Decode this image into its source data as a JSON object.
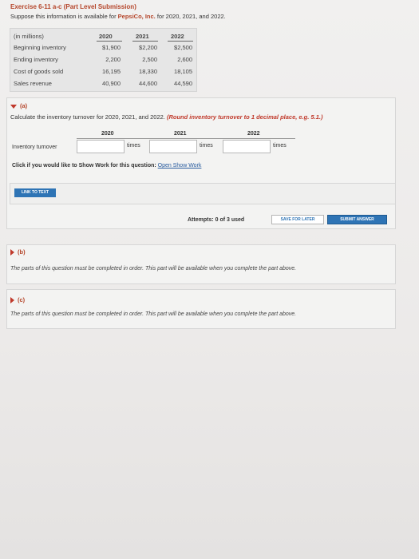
{
  "header": {
    "title": "Exercise 6-11 a-c (Part Level Submission)",
    "intro_before": "Suppose this information is available for ",
    "intro_company": "PepsiCo, Inc.",
    "intro_after": " for 2020, 2021, and 2022."
  },
  "data_table": {
    "unit_label": "(in millions)",
    "years": [
      "2020",
      "2021",
      "2022"
    ],
    "rows": [
      {
        "label": "Beginning inventory",
        "values": [
          "$1,900",
          "$2,200",
          "$2,500"
        ]
      },
      {
        "label": "Ending inventory",
        "values": [
          "2,200",
          "2,500",
          "2,600"
        ]
      },
      {
        "label": "Cost of goods sold",
        "values": [
          "16,195",
          "18,330",
          "18,105"
        ]
      },
      {
        "label": "Sales revenue",
        "values": [
          "40,900",
          "44,600",
          "44,590"
        ]
      }
    ]
  },
  "part_a": {
    "label": "(a)",
    "question": "Calculate the inventory turnover for 2020, 2021, and 2022.",
    "instruction": "(Round inventory turnover to 1 decimal place, e.g. 5.1.)",
    "years": [
      "2020",
      "2021",
      "2022"
    ],
    "row_label": "Inventory turnover",
    "unit": "times",
    "inputs": [
      "",
      "",
      ""
    ],
    "show_work_prompt": "Click if you would like to Show Work for this question:",
    "show_work_link": "Open Show Work",
    "link_to_text": "LINK TO TEXT"
  },
  "attempts": {
    "text": "Attempts: 0 of 3 used",
    "save_label": "SAVE FOR LATER",
    "submit_label": "SUBMIT ANSWER"
  },
  "part_b": {
    "label": "(b)",
    "note": "The parts of this question must be completed in order. This part will be available when you complete the part above."
  },
  "part_c": {
    "label": "(c)",
    "note": "The parts of this question must be completed in order. This part will be available when you complete the part above."
  },
  "colors": {
    "accent": "#b5452a",
    "button_blue": "#2e74b5",
    "link_blue": "#2a5d9f"
  }
}
